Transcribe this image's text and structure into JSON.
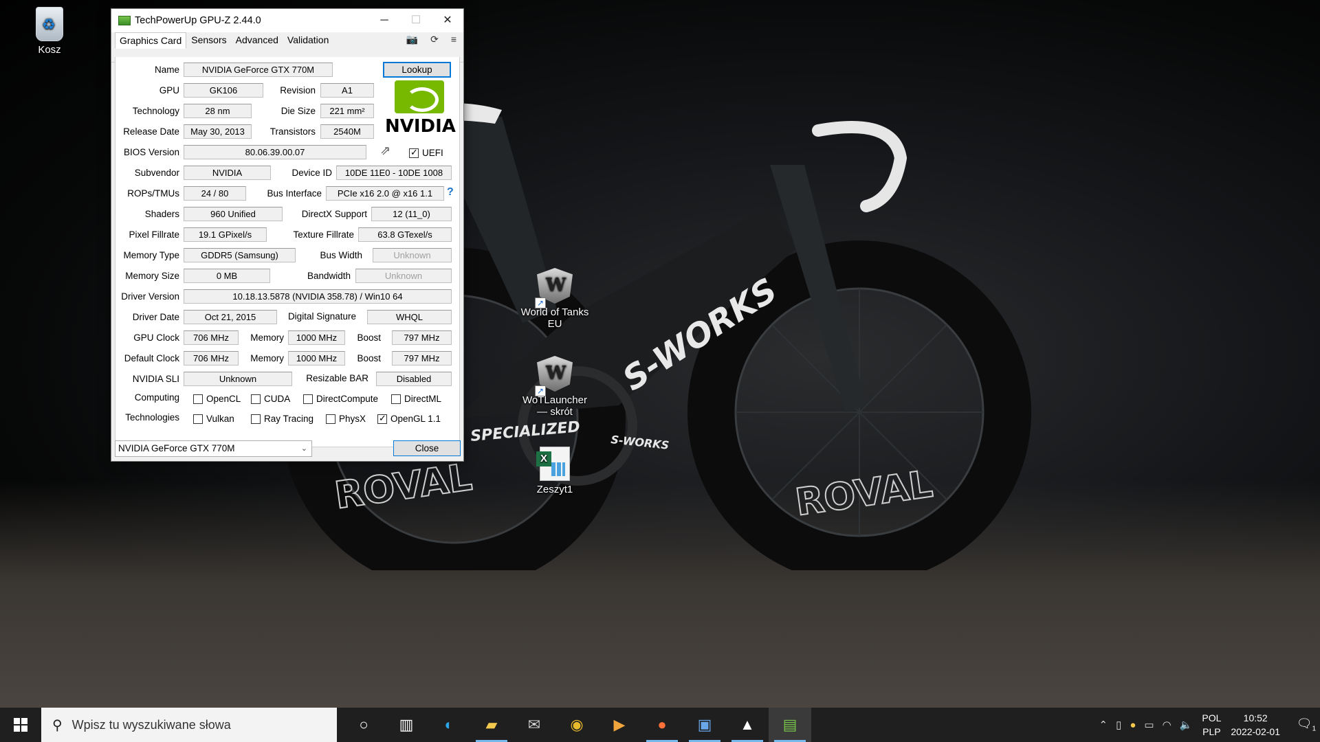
{
  "desktop": {
    "icons": [
      {
        "label": "Kosz",
        "icon": "recycle-bin-icon"
      },
      {
        "label": "World of Tanks EU",
        "icon": "world-of-tanks-icon"
      },
      {
        "label": "WoTLauncher — skrót",
        "icon": "world-of-tanks-icon"
      },
      {
        "label": "Zeszyt1",
        "icon": "excel-file-icon"
      }
    ],
    "wallpaper_text": {
      "brand": "S-WORKS",
      "chainring": "S-WORKS",
      "rim": "ROVAL",
      "frame": "SPECIALIZED"
    }
  },
  "window": {
    "title": "TechPowerUp GPU-Z 2.44.0",
    "controls": {
      "minimize": "─",
      "maximize": "☐",
      "close": "✕"
    },
    "tabs": [
      "Graphics Card",
      "Sensors",
      "Advanced",
      "Validation"
    ],
    "tab_icons": [
      "camera-icon",
      "refresh-icon",
      "menu-icon"
    ],
    "fields": {
      "name": {
        "label": "Name",
        "value": "NVIDIA GeForce GTX 770M"
      },
      "lookup": "Lookup",
      "gpu": {
        "label": "GPU",
        "value": "GK106"
      },
      "revision": {
        "label": "Revision",
        "value": "A1"
      },
      "technology": {
        "label": "Technology",
        "value": "28 nm"
      },
      "die_size": {
        "label": "Die Size",
        "value": "221 mm²"
      },
      "release_date": {
        "label": "Release Date",
        "value": "May 30, 2013"
      },
      "transistors": {
        "label": "Transistors",
        "value": "2540M"
      },
      "bios_version": {
        "label": "BIOS Version",
        "value": "80.06.39.00.07"
      },
      "uefi": {
        "label": "UEFI",
        "checked": true
      },
      "subvendor": {
        "label": "Subvendor",
        "value": "NVIDIA"
      },
      "device_id": {
        "label": "Device ID",
        "value": "10DE 11E0 - 10DE 1008"
      },
      "rops_tmus": {
        "label": "ROPs/TMUs",
        "value": "24 / 80"
      },
      "bus_interface": {
        "label": "Bus Interface",
        "value": "PCIe x16 2.0 @ x16 1.1",
        "help": "?"
      },
      "shaders": {
        "label": "Shaders",
        "value": "960 Unified"
      },
      "directx": {
        "label": "DirectX Support",
        "value": "12 (11_0)"
      },
      "pixel_fillrate": {
        "label": "Pixel Fillrate",
        "value": "19.1 GPixel/s"
      },
      "texture_fillrate": {
        "label": "Texture Fillrate",
        "value": "63.8 GTexel/s"
      },
      "memory_type": {
        "label": "Memory Type",
        "value": "GDDR5 (Samsung)"
      },
      "bus_width": {
        "label": "Bus Width",
        "value": "Unknown"
      },
      "memory_size": {
        "label": "Memory Size",
        "value": "0 MB"
      },
      "bandwidth": {
        "label": "Bandwidth",
        "value": "Unknown"
      },
      "driver_version": {
        "label": "Driver Version",
        "value": "10.18.13.5878 (NVIDIA 358.78) / Win10 64"
      },
      "driver_date": {
        "label": "Driver Date",
        "value": "Oct 21, 2015"
      },
      "digital_signature": {
        "label": "Digital Signature",
        "value": "WHQL"
      },
      "gpu_clock": {
        "label": "GPU Clock",
        "value": "706 MHz",
        "memory_label": "Memory",
        "memory": "1000 MHz",
        "boost_label": "Boost",
        "boost": "797 MHz"
      },
      "default_clock": {
        "label": "Default Clock",
        "value": "706 MHz",
        "memory_label": "Memory",
        "memory": "1000 MHz",
        "boost_label": "Boost",
        "boost": "797 MHz"
      },
      "nvidia_sli": {
        "label": "NVIDIA SLI",
        "value": "Unknown"
      },
      "resizable_bar": {
        "label": "Resizable BAR",
        "value": "Disabled"
      },
      "computing": {
        "label": "Computing",
        "items": [
          {
            "label": "OpenCL",
            "checked": false
          },
          {
            "label": "CUDA",
            "checked": false
          },
          {
            "label": "DirectCompute",
            "checked": false
          },
          {
            "label": "DirectML",
            "checked": false
          }
        ]
      },
      "technologies": {
        "label": "Technologies",
        "items": [
          {
            "label": "Vulkan",
            "checked": false
          },
          {
            "label": "Ray Tracing",
            "checked": false
          },
          {
            "label": "PhysX",
            "checked": false
          },
          {
            "label": "OpenGL 1.1",
            "checked": true
          }
        ]
      }
    },
    "vendor_logo_text": "NVIDIA",
    "gpu_select": "NVIDIA GeForce GTX 770M",
    "close_button": "Close"
  },
  "taskbar": {
    "search_placeholder": "Wpisz tu wyszukiwane słowa",
    "apps": [
      "cortana-icon",
      "task-view-icon",
      "edge-icon",
      "file-explorer-icon",
      "mail-icon",
      "chrome-icon",
      "media-player-icon",
      "firefox-icon",
      "app-window-icon",
      "photos-icon",
      "gpu-z-icon"
    ],
    "language": {
      "line1": "POL",
      "line2": "PLP"
    },
    "time": "10:52",
    "date": "2022-02-01",
    "notification_count": "1"
  },
  "colors": {
    "nvidia_green": "#76b900",
    "focus_blue": "#0078d7",
    "taskbar": "#1f1f1f"
  }
}
